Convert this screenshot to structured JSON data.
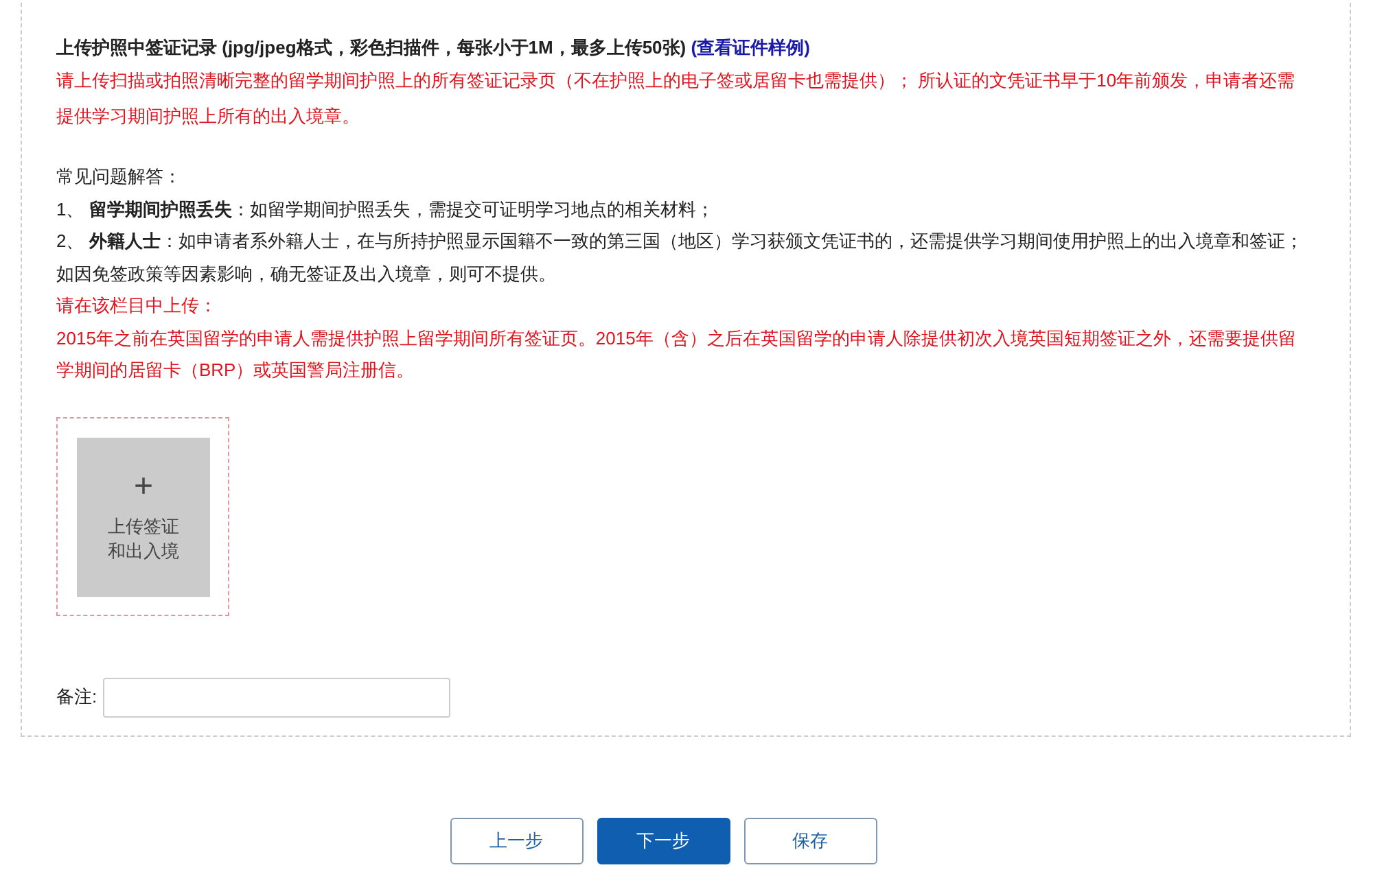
{
  "upload_section": {
    "title": "上传护照中签证记录 (jpg/jpeg格式，彩色扫描件，每张小于1M，最多上传50张)",
    "sample_link": "(查看证件样例)",
    "notice": "请上传扫描或拍照清晰完整的留学期间护照上的所有签证记录页（不在护照上的电子签或居留卡也需提供）； 所认证的文凭证书早于10年前颁发，申请者还需提供学习期间护照上所有的出入境章。",
    "faq_title": "常见问题解答：",
    "faq_items": [
      "1、 **留学期间护照丢失**：如留学期间护照丢失，需提交可证明学习地点的相关材料；",
      "2、 **外籍人士**：如申请者系外籍人士，在与所持护照显示国籍不一致的第三国（地区）学习获颁文凭证书的，还需提供学习期间使用护照上的出入境章和签证；如因免签政策等因素影响，确无签证及出入境章，则可不提供。"
    ],
    "upload_hint_title": "请在该栏目中上传：",
    "upload_hint": "2015年之前在英国留学的申请人需提供护照上留学期间所有签证页。2015年（含）之后在英国留学的申请人除提供初次入境英国短期签证之外，还需要提供留学期间的居留卡（BRP）或英国警局注册信。",
    "upload_tile": {
      "icon_text": "+",
      "label": "上传签证和出入境"
    },
    "remark": {
      "label": "备注:"
    }
  },
  "buttons": [
    {
      "label": "上一步",
      "kind": "secondary"
    },
    {
      "label": "下一步",
      "kind": "primary"
    },
    {
      "label": "保存",
      "kind": "secondary"
    }
  ]
}
